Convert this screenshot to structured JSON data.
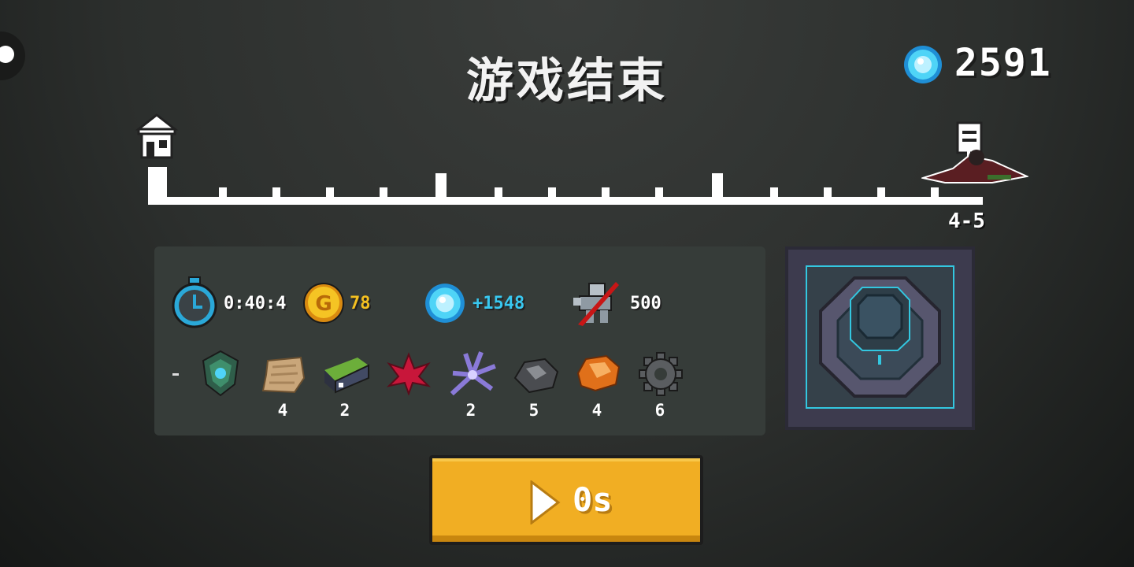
{
  "title": "游戏结束",
  "currency": {
    "icon": "blue-gem-icon",
    "count": "2591"
  },
  "progress": {
    "stage_label": "4-5",
    "start_icon": "home-icon",
    "end_icon": "boss-flag-icon",
    "completed_fraction": 1.0
  },
  "stats": {
    "time": {
      "icon": "stopwatch-icon",
      "value": "0:40:4"
    },
    "gold": {
      "icon": "gold-coin-icon",
      "value": "78"
    },
    "gems": {
      "icon": "blue-gem-icon",
      "value": "+1548"
    },
    "kills": {
      "icon": "slain-enemy-icon",
      "value": "500"
    }
  },
  "items": [
    {
      "icon": "dash-icon",
      "count": ""
    },
    {
      "icon": "green-armor-icon",
      "count": ""
    },
    {
      "icon": "cloth-scrap-icon",
      "count": "4"
    },
    {
      "icon": "battery-icon",
      "count": "2"
    },
    {
      "icon": "red-leaf-icon",
      "count": ""
    },
    {
      "icon": "purple-crystal-icon",
      "count": "2"
    },
    {
      "icon": "dark-ore-icon",
      "count": "5"
    },
    {
      "icon": "orange-ore-icon",
      "count": "4"
    },
    {
      "icon": "gear-icon",
      "count": "6"
    }
  ],
  "portal": {
    "icon": "portal-pedestal-icon"
  },
  "ad_button": {
    "label": "0s",
    "icon": "play-icon"
  },
  "colors": {
    "accent": "#f1ae23",
    "gem": "#38c8f0",
    "gold": "#f4c020",
    "panel": "#363c39"
  }
}
